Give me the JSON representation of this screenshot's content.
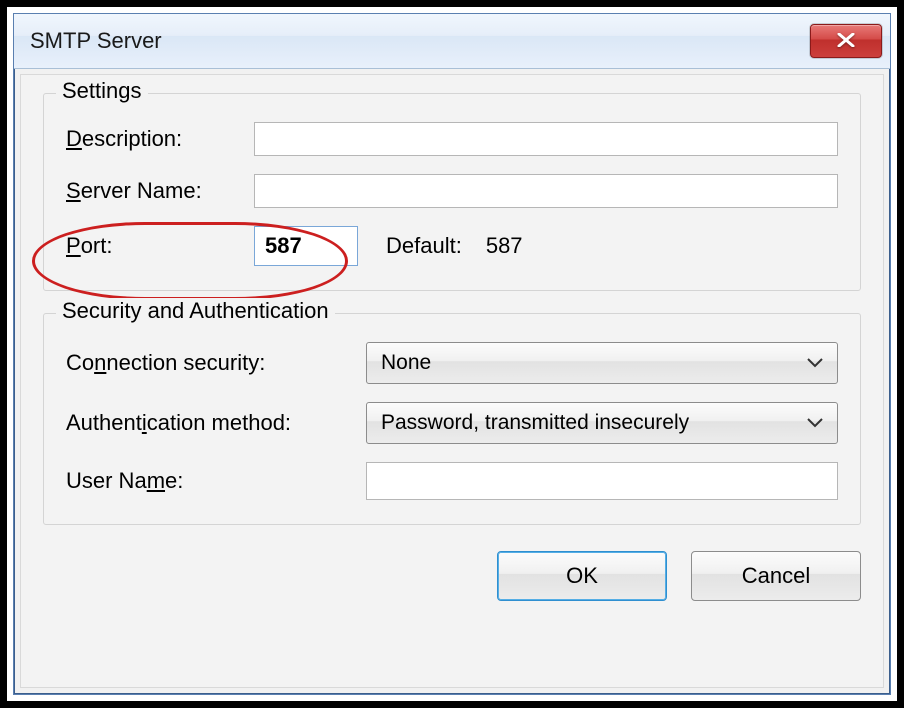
{
  "window": {
    "title": "SMTP Server"
  },
  "settings": {
    "legend": "Settings",
    "description_label_pre": "D",
    "description_label_post": "escription:",
    "description_value": "",
    "server_label_pre": "S",
    "server_label_post": "erver Name:",
    "server_value": "",
    "port_label_pre": "P",
    "port_label_post": "ort:",
    "port_value": "587",
    "default_label": "Default:",
    "default_value": "587"
  },
  "security": {
    "legend": "Security and Authentication",
    "conn_label_pre": "Co",
    "conn_label_ul": "n",
    "conn_label_post": "nection security:",
    "conn_value": "None",
    "auth_label_pre": "Authent",
    "auth_label_ul": "i",
    "auth_label_post": "cation method:",
    "auth_value": "Password, transmitted insecurely",
    "user_label_pre": "User Na",
    "user_label_ul": "m",
    "user_label_post": "e:",
    "user_value": ""
  },
  "buttons": {
    "ok": "OK",
    "cancel": "Cancel"
  }
}
